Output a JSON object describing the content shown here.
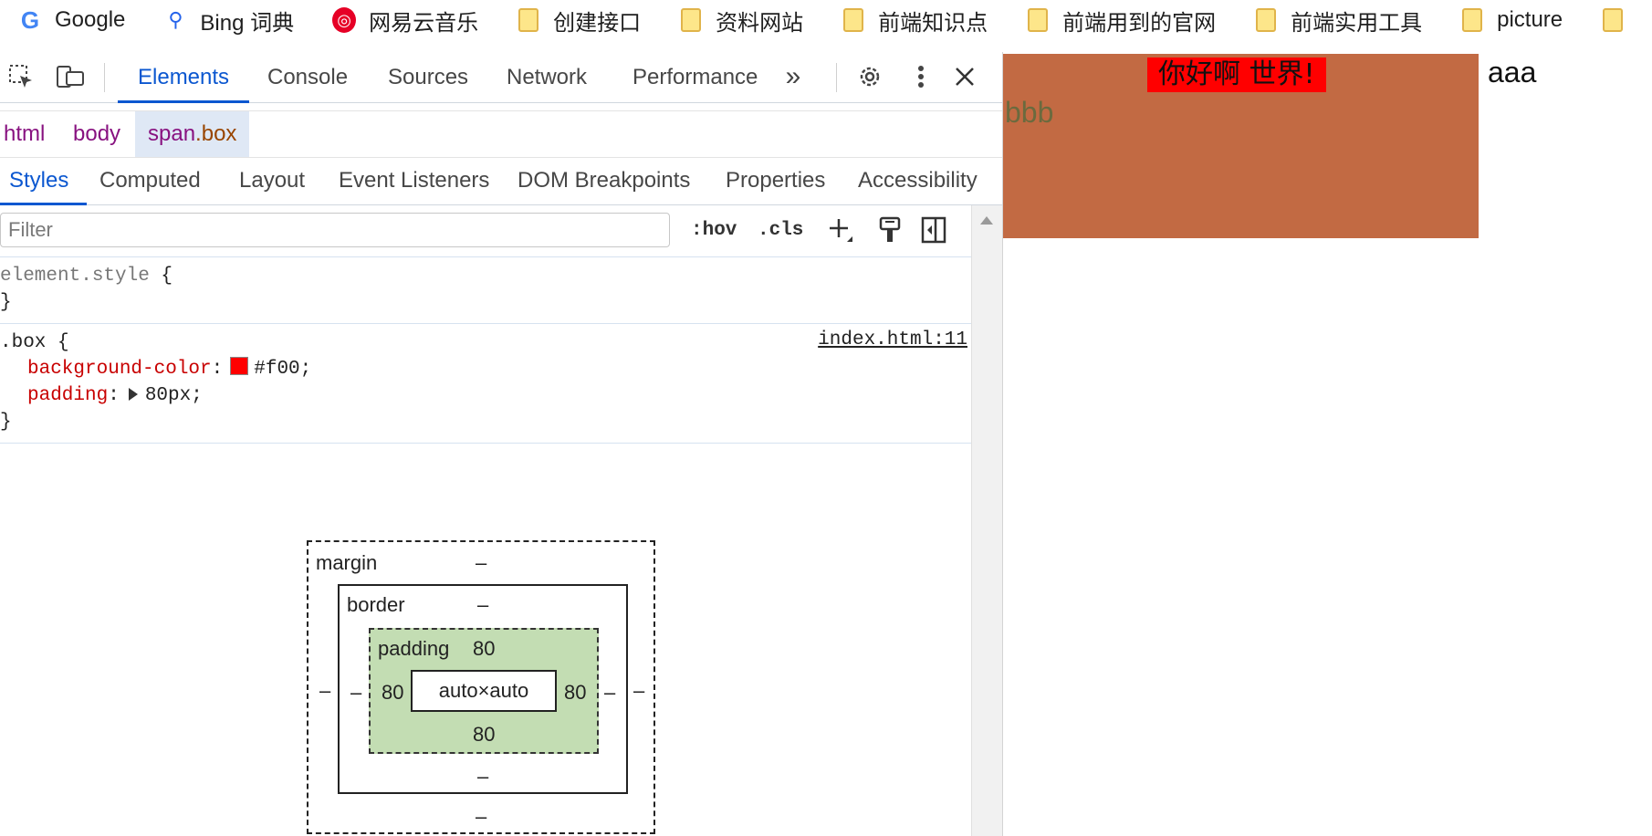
{
  "bookmarks": [
    {
      "label": "Google",
      "icon": "google-icon"
    },
    {
      "label": "Bing 词典",
      "icon": "bing-icon"
    },
    {
      "label": "网易云音乐",
      "icon": "netease-music-icon"
    },
    {
      "label": "创建接口",
      "icon": "folder-icon"
    },
    {
      "label": "资料网站",
      "icon": "folder-icon"
    },
    {
      "label": "前端知识点",
      "icon": "folder-icon"
    },
    {
      "label": "前端用到的官网",
      "icon": "folder-icon"
    },
    {
      "label": "前端实用工具",
      "icon": "folder-icon"
    },
    {
      "label": "picture",
      "icon": "folder-icon"
    }
  ],
  "devtools": {
    "tabs": [
      "Elements",
      "Console",
      "Sources",
      "Network",
      "Performance"
    ],
    "active_tab": "Elements",
    "breadcrumbs": {
      "html": "html",
      "body": "body",
      "span_tag": "span",
      "span_class": ".box"
    },
    "subtabs": [
      "Styles",
      "Computed",
      "Layout",
      "Event Listeners",
      "DOM Breakpoints",
      "Properties",
      "Accessibility"
    ],
    "active_subtab": "Styles",
    "filter_placeholder": "Filter",
    "hov_label": ":hov",
    "cls_label": ".cls",
    "element_style": {
      "selector": "element.style",
      "open": " {",
      "close": "}"
    },
    "box_rule": {
      "selector": ".box",
      "open": " {",
      "close": "}",
      "source": "index.html:11",
      "props": [
        {
          "name": "background-color",
          "value": "#f00;"
        },
        {
          "name": "padding",
          "value": "80px;"
        }
      ]
    },
    "box_model": {
      "margin_label": "margin",
      "border_label": "border",
      "padding_label": "padding",
      "margin": {
        "top": "–",
        "right": "–",
        "bottom": "–",
        "left": "–"
      },
      "border": {
        "top": "–",
        "right": "–",
        "bottom": "–",
        "left": "–"
      },
      "padding": {
        "top": "80",
        "right": "80",
        "bottom": "80",
        "left": "80"
      },
      "content": "auto×auto"
    }
  },
  "page": {
    "hello_text": "你好啊 世界!",
    "bbb_text": "bbb",
    "aaa_text": "aaa"
  },
  "colors": {
    "accent": "#0b57d0",
    "swatch": "#ff0000",
    "span_bg": "#c26a43",
    "padding_box": "#c3ddb3"
  }
}
